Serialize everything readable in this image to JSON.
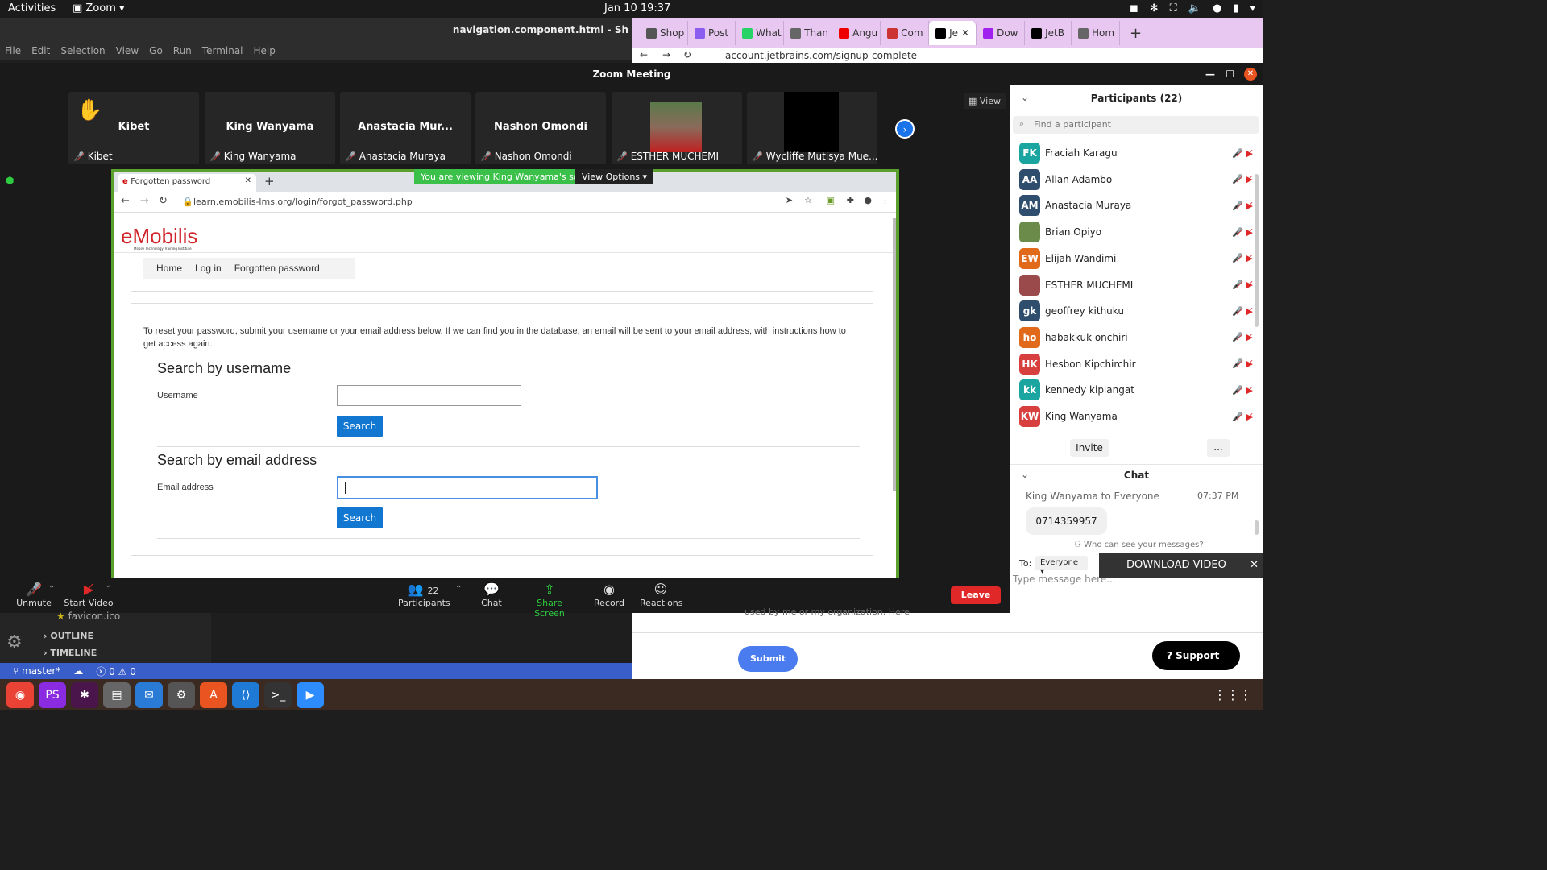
{
  "topbar": {
    "activities": "Activities",
    "app": "Zoom",
    "clock": "Jan 10  19:37"
  },
  "vscode": {
    "title": "navigation.component.html - Sh",
    "menu": [
      "File",
      "Edit",
      "Selection",
      "View",
      "Go",
      "Run",
      "Terminal",
      "Help"
    ],
    "explorer": {
      "file": "favicon.ico",
      "outline": "OUTLINE",
      "timeline": "TIMELINE"
    },
    "status": {
      "branch": "master*",
      "errors": "0",
      "warnings": "0"
    }
  },
  "chrome": {
    "tabs": [
      "Shop",
      "Post",
      "What",
      "Than",
      "Angu",
      "Com",
      "Je",
      "Dow",
      "JetB",
      "Hom"
    ],
    "url": "account.jetbrains.com/signup-complete",
    "bottom_text": "used by me or my organization.  Here",
    "submit": "Submit",
    "support": "Support"
  },
  "zoom": {
    "window_title": "Zoom Meeting",
    "view_label": "View",
    "tiles": [
      {
        "big": "Kibet",
        "label": "Kibet",
        "raised_hand": true
      },
      {
        "big": "King Wanyama",
        "label": "King Wanyama"
      },
      {
        "big": "Anastacia Mur...",
        "label": "Anastacia Muraya"
      },
      {
        "big": "Nashon Omondi",
        "label": "Nashon Omondi"
      },
      {
        "big": "",
        "label": "ESTHER MUCHEMI"
      },
      {
        "big": "",
        "label": "Wycliffe Mutisya Mue..."
      }
    ],
    "viewing_banner": "You are viewing King Wanyama's screen",
    "view_options": "View Options",
    "toolbar": {
      "unmute": "Unmute",
      "start_video": "Start Video",
      "participants": "Participants",
      "participants_count": "22",
      "chat": "Chat",
      "share": "Share Screen",
      "record": "Record",
      "reactions": "Reactions",
      "leave": "Leave"
    }
  },
  "shared": {
    "tab_title": "Forgotten password",
    "url": "learn.emobilis-lms.org/login/forgot_password.php",
    "logo": "eMobilis",
    "logo_tag": "Mobile Technology Training Institute",
    "breadcrumb": [
      "Home",
      "Log in",
      "Forgotten password"
    ],
    "intro": "To reset your password, submit your username or your email address below. If we can find you in the database, an email will be sent to your email address, with instructions how to get access again.",
    "section1": "Search by username",
    "username_label": "Username",
    "search1": "Search",
    "section2": "Search by email address",
    "email_label": "Email address",
    "search2": "Search"
  },
  "participants": {
    "title": "Participants (22)",
    "search_placeholder": "Find a participant",
    "list": [
      {
        "initials": "FK",
        "name": "Fraciah Karagu",
        "color": "#1aa5a0"
      },
      {
        "initials": "AA",
        "name": "Allan Adambo",
        "color": "#2f4e6e"
      },
      {
        "initials": "AM",
        "name": "Anastacia Muraya",
        "color": "#2f4e6e"
      },
      {
        "initials": "",
        "name": "Brian Opiyo",
        "color": "#6a8b4a"
      },
      {
        "initials": "EW",
        "name": "Elijah Wandimi",
        "color": "#e06a1a"
      },
      {
        "initials": "",
        "name": "ESTHER MUCHEMI",
        "color": "#9a4a4a"
      },
      {
        "initials": "gk",
        "name": "geoffrey kithuku",
        "color": "#2f4e6e"
      },
      {
        "initials": "ho",
        "name": "habakkuk onchiri",
        "color": "#e06a1a"
      },
      {
        "initials": "HK",
        "name": "Hesbon Kipchirchir",
        "color": "#d84040"
      },
      {
        "initials": "kk",
        "name": "kennedy kiplangat",
        "color": "#1aa5a0"
      },
      {
        "initials": "KW",
        "name": "King Wanyama",
        "color": "#d84040"
      }
    ],
    "invite": "Invite",
    "more": "..."
  },
  "chat": {
    "title": "Chat",
    "sender": "King Wanyama to Everyone",
    "time": "07:37 PM",
    "message": "0714359957",
    "who_can_see": "Who can see your messages?",
    "to_label": "To:",
    "to_value": "Everyone",
    "placeholder": "Type message here...",
    "download": "DOWNLOAD VIDEO"
  }
}
